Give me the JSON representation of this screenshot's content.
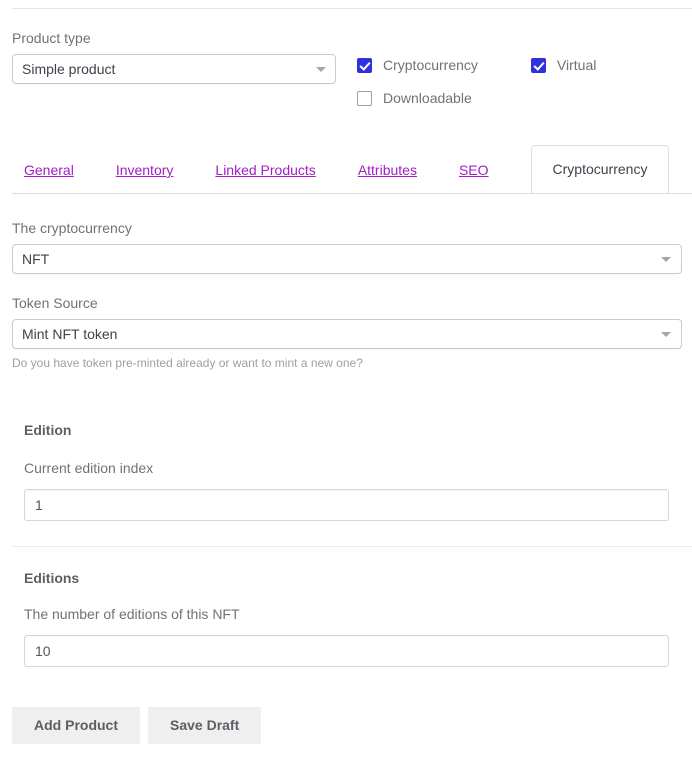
{
  "product_type": {
    "label": "Product type",
    "selected": "Simple product",
    "caret_icon": "chevron-down-icon"
  },
  "flags": [
    {
      "label": "Cryptocurrency",
      "checked": true
    },
    {
      "label": "Virtual",
      "checked": true
    },
    {
      "label": "Downloadable",
      "checked": false
    }
  ],
  "tabs": {
    "links": [
      {
        "label": "General"
      },
      {
        "label": "Inventory"
      },
      {
        "label": "Linked Products"
      },
      {
        "label": "Attributes"
      },
      {
        "label": "SEO"
      }
    ],
    "active": {
      "label": "Cryptocurrency"
    },
    "link_color": "#a020c4"
  },
  "cryptocurrency_field": {
    "label": "The cryptocurrency",
    "selected": "NFT",
    "caret_icon": "chevron-down-icon"
  },
  "token_source_field": {
    "label": "Token Source",
    "selected": "Mint NFT token",
    "caret_icon": "chevron-down-icon",
    "helper": "Do you have token pre-minted already or want to mint a new one?"
  },
  "edition_section": {
    "title": "Edition",
    "sub_label": "Current edition index",
    "value": "1",
    "placeholder": ""
  },
  "editions_section": {
    "title": "Editions",
    "sub_label": "The number of editions of this NFT",
    "value": "10",
    "placeholder": ""
  },
  "actions": {
    "primary": "Add Product",
    "secondary": "Save Draft"
  },
  "colors": {
    "checkbox_accent": "#2f31de",
    "link": "#a020c4",
    "button_bg": "#efeff0"
  }
}
